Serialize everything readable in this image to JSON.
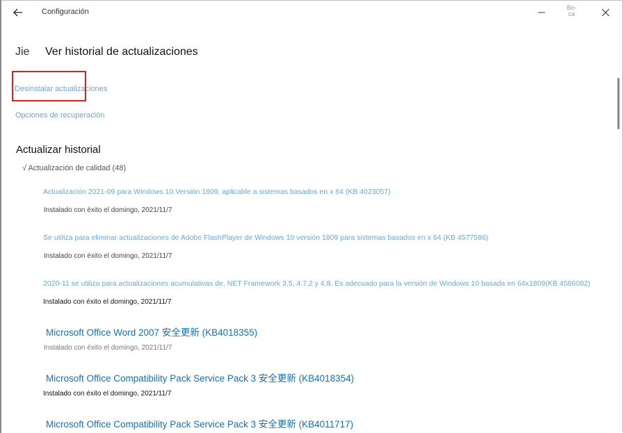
{
  "window": {
    "title": "Configuración",
    "max_label": "Bo-ca"
  },
  "page": {
    "prefix": "Jie",
    "title": "Ver historial de actualizaciones"
  },
  "links": {
    "uninstall": "Desinstalar actualizaciones",
    "recovery": "Opciones de recuperación"
  },
  "history": {
    "section_title": "Actualizar historial",
    "group_label": "√ Actualización de calidad (48)",
    "items": [
      {
        "name": "Actualización 2021-09 para Windows 10 Versión 1809, aplicable a sistemas basados en x 64 (KB 4023057)",
        "status": "Instalado con éxito el domingo, 2021/11/7"
      },
      {
        "name": "Se utiliza para eliminar actualizaciones de Adobe FlashPlayer de Windows 10 versión 1809 para sistemas basados en x 64 (KB 4577586)",
        "status": "Instalado con éxito el domingo, 2021/11/7"
      },
      {
        "name": "2020-11 se utiliza para actualizaciones acumulativas de. NET Framework 3,5, 4.7.2 y 4,8. Es adecuado para la versión de Windows 10 basada en 64x1809(KB 4586082)",
        "status": "Instalado con éxito el domingo, 2021/11/7"
      },
      {
        "name": "Microsoft Office Word 2007 安全更新 (KB4018355)",
        "status": "Instalado con éxito el domingo, 2021/11/7"
      },
      {
        "name": "Microsoft Office Compatibility Pack Service Pack 3 安全更新 (KB4018354)",
        "status": "Instalado con éxito el domingo, 2021/11/7"
      },
      {
        "name": "Microsoft Office Compatibility Pack Service Pack 3 安全更新 (KB4011717)"
      }
    ]
  }
}
